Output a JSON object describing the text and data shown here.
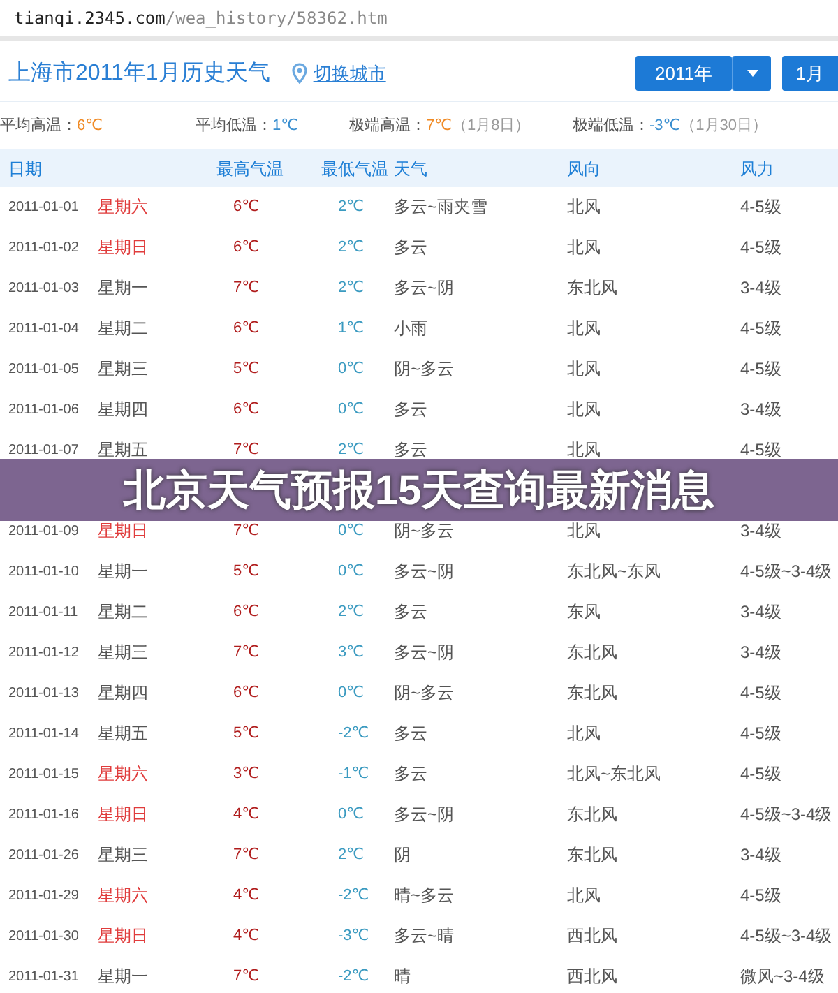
{
  "address_bar": {
    "host": "tianqi.2345.com",
    "path": "/wea_history/58362.htm"
  },
  "header": {
    "title": "上海市2011年1月历史天气",
    "switch_city": "切换城市",
    "year_button": "2011年",
    "month_button": "1月"
  },
  "stats": [
    {
      "label": "平均高温：",
      "value": "6℃",
      "kind": "high"
    },
    {
      "label": "平均低温：",
      "value": "1℃",
      "kind": "low"
    },
    {
      "label": "极端高温：",
      "value": "7℃",
      "kind": "high",
      "note": "（1月8日）"
    },
    {
      "label": "极端低温：",
      "value": "-3℃",
      "kind": "low",
      "note": "（1月30日）"
    }
  ],
  "table": {
    "columns": [
      "日期",
      "最高气温",
      "最低气温",
      "天气",
      "风向",
      "风力"
    ],
    "rows": [
      {
        "kind": "day",
        "date": "2011-01-01",
        "weekday": "星期六",
        "weekend": true,
        "high": "6℃",
        "low": "2℃",
        "weather": "多云~雨夹雪",
        "wind_dir": "北风",
        "wind_force": "4-5级"
      },
      {
        "kind": "day",
        "date": "2011-01-02",
        "weekday": "星期日",
        "weekend": true,
        "high": "6℃",
        "low": "2℃",
        "weather": "多云",
        "wind_dir": "北风",
        "wind_force": "4-5级"
      },
      {
        "kind": "day",
        "date": "2011-01-03",
        "weekday": "星期一",
        "weekend": false,
        "high": "7℃",
        "low": "2℃",
        "weather": "多云~阴",
        "wind_dir": "东北风",
        "wind_force": "3-4级"
      },
      {
        "kind": "day",
        "date": "2011-01-04",
        "weekday": "星期二",
        "weekend": false,
        "high": "6℃",
        "low": "1℃",
        "weather": "小雨",
        "wind_dir": "北风",
        "wind_force": "4-5级"
      },
      {
        "kind": "day",
        "date": "2011-01-05",
        "weekday": "星期三",
        "weekend": false,
        "high": "5℃",
        "low": "0℃",
        "weather": "阴~多云",
        "wind_dir": "北风",
        "wind_force": "4-5级"
      },
      {
        "kind": "day",
        "date": "2011-01-06",
        "weekday": "星期四",
        "weekend": false,
        "high": "6℃",
        "low": "0℃",
        "weather": "多云",
        "wind_dir": "北风",
        "wind_force": "3-4级"
      },
      {
        "kind": "day",
        "date": "2011-01-07",
        "weekday": "星期五",
        "weekend": false,
        "high": "7℃",
        "low": "2℃",
        "weather": "多云",
        "wind_dir": "北风",
        "wind_force": "4-5级"
      },
      {
        "kind": "covered"
      },
      {
        "kind": "day",
        "date": "2011-01-09",
        "weekday": "星期日",
        "weekend": true,
        "high": "7℃",
        "low": "0℃",
        "weather": "阴~多云",
        "wind_dir": "北风",
        "wind_force": "3-4级"
      },
      {
        "kind": "day",
        "date": "2011-01-10",
        "weekday": "星期一",
        "weekend": false,
        "high": "5℃",
        "low": "0℃",
        "weather": "多云~阴",
        "wind_dir": "东北风~东风",
        "wind_force": "4-5级~3-4级"
      },
      {
        "kind": "day",
        "date": "2011-01-11",
        "weekday": "星期二",
        "weekend": false,
        "high": "6℃",
        "low": "2℃",
        "weather": "多云",
        "wind_dir": "东风",
        "wind_force": "3-4级"
      },
      {
        "kind": "day",
        "date": "2011-01-12",
        "weekday": "星期三",
        "weekend": false,
        "high": "7℃",
        "low": "3℃",
        "weather": "多云~阴",
        "wind_dir": "东北风",
        "wind_force": "3-4级"
      },
      {
        "kind": "day",
        "date": "2011-01-13",
        "weekday": "星期四",
        "weekend": false,
        "high": "6℃",
        "low": "0℃",
        "weather": "阴~多云",
        "wind_dir": "东北风",
        "wind_force": "4-5级"
      },
      {
        "kind": "day",
        "date": "2011-01-14",
        "weekday": "星期五",
        "weekend": false,
        "high": "5℃",
        "low": "-2℃",
        "weather": "多云",
        "wind_dir": "北风",
        "wind_force": "4-5级"
      },
      {
        "kind": "day",
        "date": "2011-01-15",
        "weekday": "星期六",
        "weekend": true,
        "high": "3℃",
        "low": "-1℃",
        "weather": "多云",
        "wind_dir": "北风~东北风",
        "wind_force": "4-5级"
      },
      {
        "kind": "day",
        "date": "2011-01-16",
        "weekday": "星期日",
        "weekend": true,
        "high": "4℃",
        "low": "0℃",
        "weather": "多云~阴",
        "wind_dir": "东北风",
        "wind_force": "4-5级~3-4级"
      },
      {
        "kind": "day",
        "date": "2011-01-26",
        "weekday": "星期三",
        "weekend": false,
        "high": "7℃",
        "low": "2℃",
        "weather": "阴",
        "wind_dir": "东北风",
        "wind_force": "3-4级"
      },
      {
        "kind": "day",
        "date": "2011-01-29",
        "weekday": "星期六",
        "weekend": true,
        "high": "4℃",
        "low": "-2℃",
        "weather": "晴~多云",
        "wind_dir": "北风",
        "wind_force": "4-5级"
      },
      {
        "kind": "day",
        "date": "2011-01-30",
        "weekday": "星期日",
        "weekend": true,
        "high": "4℃",
        "low": "-3℃",
        "weather": "多云~晴",
        "wind_dir": "西北风",
        "wind_force": "4-5级~3-4级"
      },
      {
        "kind": "day",
        "date": "2011-01-31",
        "weekday": "星期一",
        "weekend": false,
        "high": "7℃",
        "low": "-2℃",
        "weather": "晴",
        "wind_dir": "西北风",
        "wind_force": "微风~3-4级"
      }
    ]
  },
  "banner": {
    "text": "北京天气预报15天查询最新消息"
  }
}
